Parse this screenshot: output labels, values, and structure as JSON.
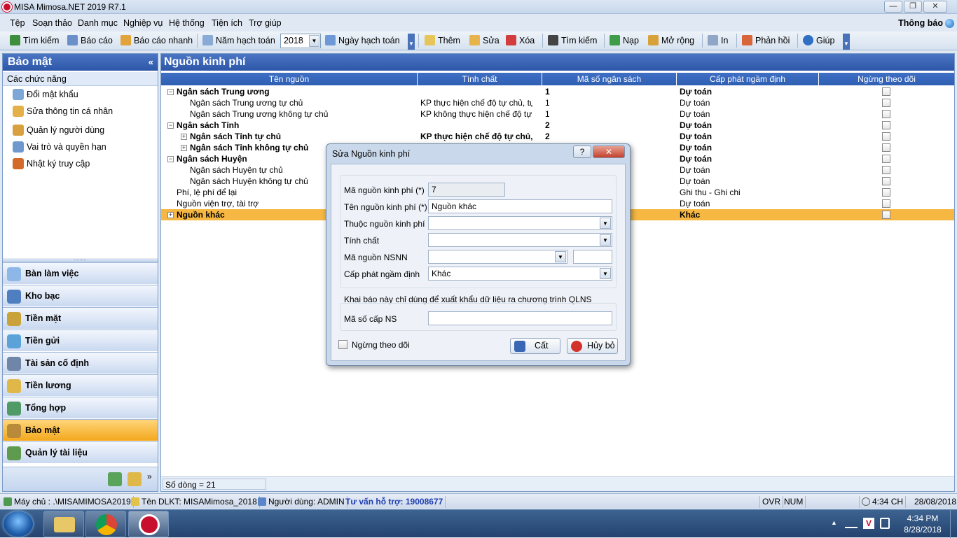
{
  "app": {
    "title": "MISA Mimosa.NET 2019 R7.1",
    "notify": "Thông báo"
  },
  "menu": [
    "Tệp",
    "Soạn thảo",
    "Danh mục",
    "Nghiệp vụ",
    "Hệ thống",
    "Tiện ích",
    "Trợ giúp"
  ],
  "toolbar": {
    "search": "Tìm kiếm",
    "report": "Báo cáo",
    "quick_report": "Báo cáo nhanh",
    "fiscal_year_label": "Năm hạch toán",
    "fiscal_year": "2018",
    "posting_date": "Ngày hạch toán",
    "add": "Thêm",
    "edit": "Sửa",
    "delete": "Xóa",
    "find": "Tìm kiếm",
    "load": "Nạp",
    "expand": "Mở rộng",
    "print": "In",
    "feedback": "Phản hồi",
    "help": "Giúp"
  },
  "left": {
    "header": "Bảo mật",
    "subheader": "Các chức năng",
    "items": [
      {
        "label": "Đổi mật khẩu",
        "icon": "key-icon"
      },
      {
        "label": "Sửa thông tin cá nhân",
        "icon": "user-edit-icon"
      },
      {
        "label": "Quản lý người dùng",
        "icon": "users-icon"
      },
      {
        "label": "Vai trò và quyền hạn",
        "icon": "role-icon"
      },
      {
        "label": "Nhật ký truy cập",
        "icon": "log-icon"
      }
    ],
    "nav": [
      {
        "label": "Bàn làm việc",
        "icon": "desk-icon"
      },
      {
        "label": "Kho bạc",
        "icon": "treasury-icon"
      },
      {
        "label": "Tiền mặt",
        "icon": "cash-icon"
      },
      {
        "label": "Tiền gửi",
        "icon": "deposit-icon"
      },
      {
        "label": "Tài sản cố định",
        "icon": "asset-icon"
      },
      {
        "label": "Tiền lương",
        "icon": "salary-icon"
      },
      {
        "label": "Tổng hợp",
        "icon": "ledger-icon"
      },
      {
        "label": "Bảo mật",
        "icon": "security-icon"
      },
      {
        "label": "Quản lý tài liệu",
        "icon": "documents-icon"
      }
    ],
    "active_nav": "Bảo mật"
  },
  "main": {
    "title": "Nguồn kinh phí",
    "columns": [
      "Tên nguồn",
      "Tính chất",
      "Mã số ngân sách",
      "Cấp phát ngầm định",
      "Ngừng theo dõi"
    ],
    "rows": [
      {
        "name": "Ngân sách Trung ương",
        "nature": "",
        "code": "1",
        "alloc": "Dự toán",
        "bold": true,
        "expander": "−",
        "level": 0
      },
      {
        "name": "Ngân sách Trung ương tự chủ",
        "nature": "KP thực hiện chế độ tự chủ, tự...",
        "code": "1",
        "alloc": "Dự toán",
        "bold": false,
        "expander": "",
        "level": 1
      },
      {
        "name": "Ngân sách Trung ương không tự chủ",
        "nature": "KP không thực hiện chế độ tự...",
        "code": "1",
        "alloc": "Dự toán",
        "bold": false,
        "expander": "",
        "level": 1
      },
      {
        "name": "Ngân sách Tỉnh",
        "nature": "",
        "code": "2",
        "alloc": "Dự toán",
        "bold": true,
        "expander": "−",
        "level": 0
      },
      {
        "name": "Ngân sách Tỉnh tự chủ",
        "nature": "KP thực hiện chế độ tự chủ, tự...",
        "code": "2",
        "alloc": "Dự toán",
        "bold": true,
        "expander": "+",
        "level": 1
      },
      {
        "name": "Ngân sách Tỉnh không tự chủ",
        "nature": "",
        "code": "",
        "alloc": "Dự toán",
        "bold": true,
        "expander": "+",
        "level": 1
      },
      {
        "name": "Ngân sách Huyện",
        "nature": "",
        "code": "",
        "alloc": "Dự toán",
        "bold": true,
        "expander": "−",
        "level": 0
      },
      {
        "name": "Ngân sách Huyện tự chủ",
        "nature": "",
        "code": "",
        "alloc": "Dự toán",
        "bold": false,
        "expander": "",
        "level": 1
      },
      {
        "name": "Ngân sách Huyện không tự chủ",
        "nature": "",
        "code": "",
        "alloc": "Dự toán",
        "bold": false,
        "expander": "",
        "level": 1
      },
      {
        "name": "Phí, lệ phí để lại",
        "nature": "",
        "code": "",
        "alloc": "Ghi thu - Ghi chi",
        "bold": false,
        "expander": "",
        "level": 0
      },
      {
        "name": "Nguồn viện trợ, tài trợ",
        "nature": "",
        "code": "",
        "alloc": "Dự toán",
        "bold": false,
        "expander": "",
        "level": 0
      },
      {
        "name": "Nguồn khác",
        "nature": "",
        "code": "",
        "alloc": "Khác",
        "bold": true,
        "expander": "+",
        "level": 0,
        "selected": true
      }
    ],
    "row_count": "Số dòng = 21"
  },
  "dialog": {
    "title": "Sửa Nguồn kinh phí",
    "help_btn": "?",
    "close_btn": "✕",
    "fields": {
      "code_label": "Mã nguồn kinh phí (*)",
      "code_value": "7",
      "name_label": "Tên nguồn kinh phí (*)",
      "name_value": "Nguồn khác",
      "parent_label": "Thuộc nguồn kinh phí",
      "parent_value": "",
      "nature_label": "Tính chất",
      "nature_value": "",
      "nsnn_label": "Mã nguồn NSNN",
      "nsnn_value": "",
      "nsnn_extra": "",
      "alloc_label": "Cấp phát ngầm định",
      "alloc_value": "Khác"
    },
    "note": "Khai báo này chỉ dùng để xuất khẩu dữ liệu ra chương trình QLNS",
    "budget_code_label": "Mã số cấp NS",
    "budget_code_value": "",
    "stop_tracking": "Ngừng theo dõi",
    "save": "Cất",
    "cancel": "Hủy bỏ"
  },
  "status": {
    "server": "Máy chủ : .\\MISAMIMOSA2019",
    "db": "Tên DLKT: MISAMimosa_2018",
    "user": "Người dùng: ADMIN",
    "support": "Tư vấn hỗ trợ: 19008677",
    "ovr": "OVR",
    "num": "NUM",
    "time": "4:34 CH",
    "date": "28/08/2018"
  },
  "taskbar": {
    "time": "4:34 PM",
    "date": "8/28/2018"
  },
  "colors": {
    "accent": "#2d56a8",
    "selected": "#f7b843",
    "support": "#1f3fb0"
  }
}
